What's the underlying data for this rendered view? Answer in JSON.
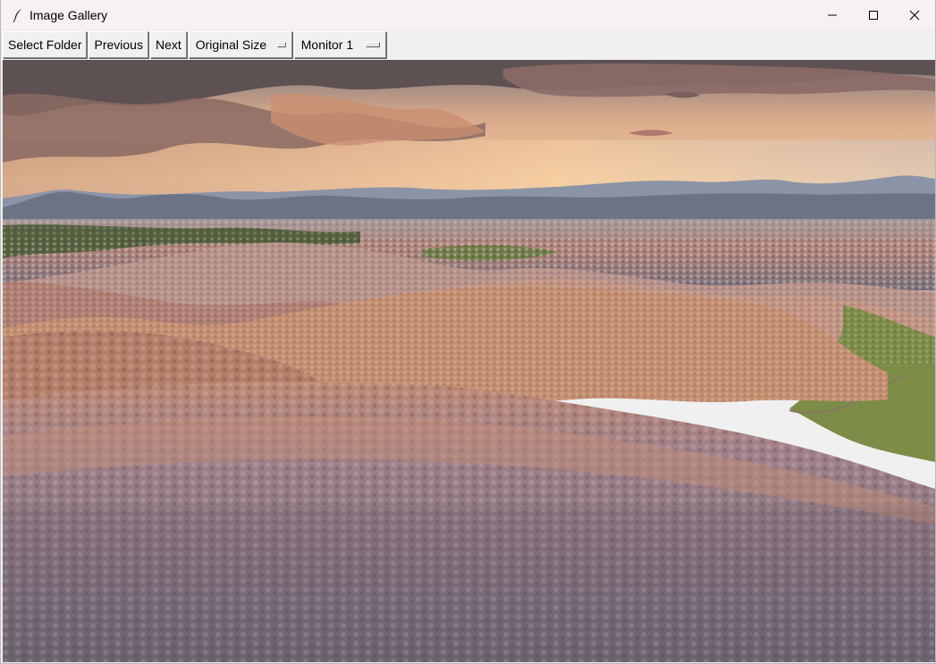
{
  "window": {
    "title": "Image Gallery",
    "icon": "feather-icon",
    "controls": [
      "minimize-icon",
      "maximize-icon",
      "close-icon"
    ]
  },
  "toolbar": {
    "select_folder_label": "Select Folder",
    "previous_label": "Previous",
    "next_label": "Next",
    "size_option": "Original Size",
    "monitor_option": "Monitor 1"
  },
  "image": {
    "subject": "landscape-photo",
    "colors": {
      "sky_top": "#6f6a72",
      "sky_glow": "#f3c59a",
      "cloud": "#5b4d4e",
      "mountains": "#6e7a8c",
      "hills_warm": "#c7916d",
      "hills_cool": "#8f8593",
      "grass": "#7c8a4a"
    }
  }
}
